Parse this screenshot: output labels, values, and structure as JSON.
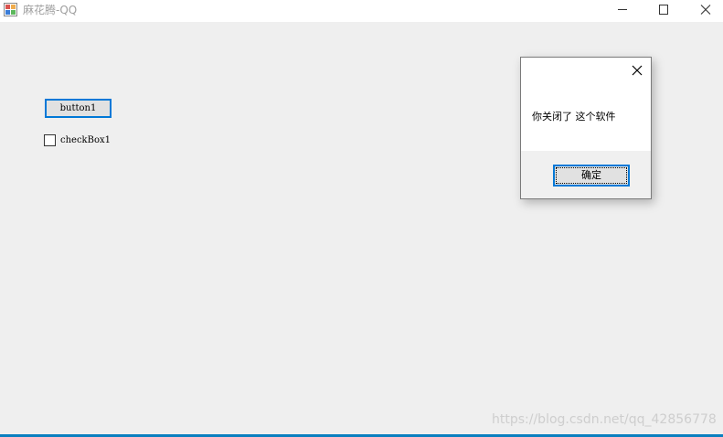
{
  "window": {
    "title": "麻花腾-QQ",
    "controls": [
      "minimize-icon",
      "maximize-icon",
      "close-icon"
    ]
  },
  "form": {
    "button_label": "button1",
    "checkbox_label": "checkBox1",
    "checkbox_checked": false
  },
  "dialog": {
    "message": "你关闭了 这个软件",
    "ok_label": "确定"
  },
  "watermark": "https://blog.csdn.net/qq_42856778",
  "colors": {
    "accent": "#0078d7",
    "background": "#efefef",
    "taskbar": "#0a7fbf"
  }
}
